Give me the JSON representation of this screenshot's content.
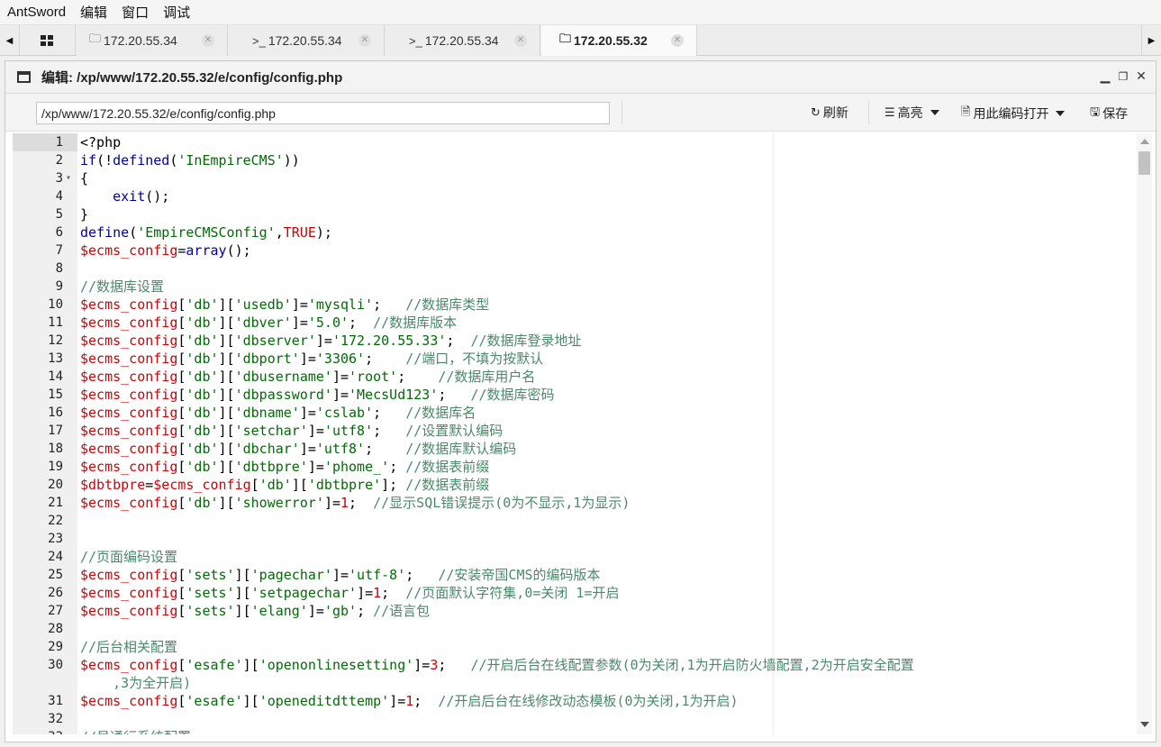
{
  "menu": [
    "AntSword",
    "编辑",
    "窗口",
    "调试"
  ],
  "tabs": [
    {
      "icon": "folder-icon",
      "glyph": "🗀",
      "label": "172.20.55.34",
      "active": false
    },
    {
      "icon": "terminal-icon",
      "glyph": ">_",
      "label": "172.20.55.34",
      "active": false
    },
    {
      "icon": "terminal-icon",
      "glyph": ">_",
      "label": "172.20.55.34",
      "active": false
    },
    {
      "icon": "folder-icon",
      "glyph": "🗀",
      "label": "172.20.55.32",
      "active": true
    }
  ],
  "panel": {
    "title": "编辑: /xp/www/172.20.55.32/e/config/config.php"
  },
  "toolbar": {
    "path_value": "/xp/www/172.20.55.32/e/config/config.php",
    "refresh_label": "刷新",
    "highlight_label": "高亮",
    "open_encoding_label": "用此编码打开",
    "save_label": "保存"
  },
  "editor": {
    "lines": [
      {
        "n": "1",
        "code": [
          [
            "p",
            "<?php"
          ]
        ]
      },
      {
        "n": "2",
        "code": [
          [
            "k",
            "if"
          ],
          [
            "p",
            "(!"
          ],
          [
            "k",
            "defined"
          ],
          [
            "p",
            "("
          ],
          [
            "s",
            "'InEmpireCMS'"
          ],
          [
            "p",
            "))"
          ]
        ]
      },
      {
        "n": "3",
        "fold": true,
        "code": [
          [
            "p",
            "{"
          ]
        ]
      },
      {
        "n": "4",
        "code": [
          [
            "p",
            "    "
          ],
          [
            "k",
            "exit"
          ],
          [
            "p",
            "();"
          ]
        ]
      },
      {
        "n": "5",
        "code": [
          [
            "p",
            "}"
          ]
        ]
      },
      {
        "n": "6",
        "code": [
          [
            "k",
            "define"
          ],
          [
            "p",
            "("
          ],
          [
            "s",
            "'EmpireCMSConfig'"
          ],
          [
            "p",
            ","
          ],
          [
            "bool",
            "TRUE"
          ],
          [
            "p",
            ");"
          ]
        ]
      },
      {
        "n": "7",
        "code": [
          [
            "v",
            "$ecms_config"
          ],
          [
            "p",
            "="
          ],
          [
            "k",
            "array"
          ],
          [
            "p",
            "();"
          ]
        ]
      },
      {
        "n": "8",
        "code": []
      },
      {
        "n": "9",
        "code": [
          [
            "c",
            "//数据库设置"
          ]
        ]
      },
      {
        "n": "10",
        "code": [
          [
            "v",
            "$ecms_config"
          ],
          [
            "p",
            "["
          ],
          [
            "s",
            "'db'"
          ],
          [
            "p",
            "]["
          ],
          [
            "s",
            "'usedb'"
          ],
          [
            "p",
            "]="
          ],
          [
            "s",
            "'mysqli'"
          ],
          [
            "p",
            ";   "
          ],
          [
            "c",
            "//数据库类型"
          ]
        ]
      },
      {
        "n": "11",
        "code": [
          [
            "v",
            "$ecms_config"
          ],
          [
            "p",
            "["
          ],
          [
            "s",
            "'db'"
          ],
          [
            "p",
            "]["
          ],
          [
            "s",
            "'dbver'"
          ],
          [
            "p",
            "]="
          ],
          [
            "s",
            "'5.0'"
          ],
          [
            "p",
            ";  "
          ],
          [
            "c",
            "//数据库版本"
          ]
        ]
      },
      {
        "n": "12",
        "code": [
          [
            "v",
            "$ecms_config"
          ],
          [
            "p",
            "["
          ],
          [
            "s",
            "'db'"
          ],
          [
            "p",
            "]["
          ],
          [
            "s",
            "'dbserver'"
          ],
          [
            "p",
            "]="
          ],
          [
            "s",
            "'172.20.55.33'"
          ],
          [
            "p",
            ";  "
          ],
          [
            "c",
            "//数据库登录地址"
          ]
        ]
      },
      {
        "n": "13",
        "code": [
          [
            "v",
            "$ecms_config"
          ],
          [
            "p",
            "["
          ],
          [
            "s",
            "'db'"
          ],
          [
            "p",
            "]["
          ],
          [
            "s",
            "'dbport'"
          ],
          [
            "p",
            "]="
          ],
          [
            "s",
            "'3306'"
          ],
          [
            "p",
            ";    "
          ],
          [
            "c",
            "//端口，不填为按默认"
          ]
        ]
      },
      {
        "n": "14",
        "code": [
          [
            "v",
            "$ecms_config"
          ],
          [
            "p",
            "["
          ],
          [
            "s",
            "'db'"
          ],
          [
            "p",
            "]["
          ],
          [
            "s",
            "'dbusername'"
          ],
          [
            "p",
            "]="
          ],
          [
            "s",
            "'root'"
          ],
          [
            "p",
            ";    "
          ],
          [
            "c",
            "//数据库用户名"
          ]
        ]
      },
      {
        "n": "15",
        "code": [
          [
            "v",
            "$ecms_config"
          ],
          [
            "p",
            "["
          ],
          [
            "s",
            "'db'"
          ],
          [
            "p",
            "]["
          ],
          [
            "s",
            "'dbpassword'"
          ],
          [
            "p",
            "]="
          ],
          [
            "s",
            "'MecsUd123'"
          ],
          [
            "p",
            ";   "
          ],
          [
            "c",
            "//数据库密码"
          ]
        ]
      },
      {
        "n": "16",
        "code": [
          [
            "v",
            "$ecms_config"
          ],
          [
            "p",
            "["
          ],
          [
            "s",
            "'db'"
          ],
          [
            "p",
            "]["
          ],
          [
            "s",
            "'dbname'"
          ],
          [
            "p",
            "]="
          ],
          [
            "s",
            "'cslab'"
          ],
          [
            "p",
            ";   "
          ],
          [
            "c",
            "//数据库名"
          ]
        ]
      },
      {
        "n": "17",
        "code": [
          [
            "v",
            "$ecms_config"
          ],
          [
            "p",
            "["
          ],
          [
            "s",
            "'db'"
          ],
          [
            "p",
            "]["
          ],
          [
            "s",
            "'setchar'"
          ],
          [
            "p",
            "]="
          ],
          [
            "s",
            "'utf8'"
          ],
          [
            "p",
            ";   "
          ],
          [
            "c",
            "//设置默认编码"
          ]
        ]
      },
      {
        "n": "18",
        "code": [
          [
            "v",
            "$ecms_config"
          ],
          [
            "p",
            "["
          ],
          [
            "s",
            "'db'"
          ],
          [
            "p",
            "]["
          ],
          [
            "s",
            "'dbchar'"
          ],
          [
            "p",
            "]="
          ],
          [
            "s",
            "'utf8'"
          ],
          [
            "p",
            ";    "
          ],
          [
            "c",
            "//数据库默认编码"
          ]
        ]
      },
      {
        "n": "19",
        "code": [
          [
            "v",
            "$ecms_config"
          ],
          [
            "p",
            "["
          ],
          [
            "s",
            "'db'"
          ],
          [
            "p",
            "]["
          ],
          [
            "s",
            "'dbtbpre'"
          ],
          [
            "p",
            "]="
          ],
          [
            "s",
            "'phome_'"
          ],
          [
            "p",
            "; "
          ],
          [
            "c",
            "//数据表前缀"
          ]
        ]
      },
      {
        "n": "20",
        "code": [
          [
            "v",
            "$dbtbpre"
          ],
          [
            "p",
            "="
          ],
          [
            "v",
            "$ecms_config"
          ],
          [
            "p",
            "["
          ],
          [
            "s",
            "'db'"
          ],
          [
            "p",
            "]["
          ],
          [
            "s",
            "'dbtbpre'"
          ],
          [
            "p",
            "]; "
          ],
          [
            "c",
            "//数据表前缀"
          ]
        ]
      },
      {
        "n": "21",
        "code": [
          [
            "v",
            "$ecms_config"
          ],
          [
            "p",
            "["
          ],
          [
            "s",
            "'db'"
          ],
          [
            "p",
            "]["
          ],
          [
            "s",
            "'showerror'"
          ],
          [
            "p",
            "]="
          ],
          [
            "bool",
            "1"
          ],
          [
            "p",
            ";  "
          ],
          [
            "c",
            "//显示SQL错误提示(0为不显示,1为显示)"
          ]
        ]
      },
      {
        "n": "22",
        "code": []
      },
      {
        "n": "23",
        "code": []
      },
      {
        "n": "24",
        "code": [
          [
            "c",
            "//页面编码设置"
          ]
        ]
      },
      {
        "n": "25",
        "code": [
          [
            "v",
            "$ecms_config"
          ],
          [
            "p",
            "["
          ],
          [
            "s",
            "'sets'"
          ],
          [
            "p",
            "]["
          ],
          [
            "s",
            "'pagechar'"
          ],
          [
            "p",
            "]="
          ],
          [
            "s",
            "'utf-8'"
          ],
          [
            "p",
            ";   "
          ],
          [
            "c",
            "//安装帝国CMS的编码版本"
          ]
        ]
      },
      {
        "n": "26",
        "code": [
          [
            "v",
            "$ecms_config"
          ],
          [
            "p",
            "["
          ],
          [
            "s",
            "'sets'"
          ],
          [
            "p",
            "]["
          ],
          [
            "s",
            "'setpagechar'"
          ],
          [
            "p",
            "]="
          ],
          [
            "bool",
            "1"
          ],
          [
            "p",
            ";  "
          ],
          [
            "c",
            "//页面默认字符集,0=关闭 1=开启"
          ]
        ]
      },
      {
        "n": "27",
        "code": [
          [
            "v",
            "$ecms_config"
          ],
          [
            "p",
            "["
          ],
          [
            "s",
            "'sets'"
          ],
          [
            "p",
            "]["
          ],
          [
            "s",
            "'elang'"
          ],
          [
            "p",
            "]="
          ],
          [
            "s",
            "'gb'"
          ],
          [
            "p",
            "; "
          ],
          [
            "c",
            "//语言包"
          ]
        ]
      },
      {
        "n": "28",
        "code": []
      },
      {
        "n": "29",
        "code": [
          [
            "c",
            "//后台相关配置"
          ]
        ]
      },
      {
        "n": "30",
        "tall": true,
        "code": [
          [
            "v",
            "$ecms_config"
          ],
          [
            "p",
            "["
          ],
          [
            "s",
            "'esafe'"
          ],
          [
            "p",
            "]["
          ],
          [
            "s",
            "'openonlinesetting'"
          ],
          [
            "p",
            "]="
          ],
          [
            "bool",
            "3"
          ],
          [
            "p",
            ";   "
          ],
          [
            "c",
            "//开启后台在线配置参数(0为关闭,1为开启防火墙配置,2为开启安全配置\n    ,3为全开启)"
          ]
        ]
      },
      {
        "n": "31",
        "code": [
          [
            "v",
            "$ecms_config"
          ],
          [
            "p",
            "["
          ],
          [
            "s",
            "'esafe'"
          ],
          [
            "p",
            "]["
          ],
          [
            "s",
            "'openeditdttemp'"
          ],
          [
            "p",
            "]="
          ],
          [
            "bool",
            "1"
          ],
          [
            "p",
            ";  "
          ],
          [
            "c",
            "//开启后台在线修改动态模板(0为关闭,1为开启)"
          ]
        ]
      },
      {
        "n": "32",
        "code": []
      },
      {
        "n": "33",
        "code": [
          [
            "c",
            "//易通行系统配置"
          ]
        ]
      }
    ]
  }
}
